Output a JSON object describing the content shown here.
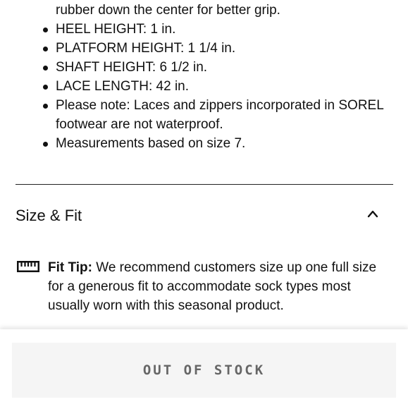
{
  "product_details": {
    "items": [
      {
        "text": "rubber down the center for better grip.",
        "continuation": true
      },
      {
        "text": "HEEL HEIGHT: 1 in.",
        "continuation": false
      },
      {
        "text": "PLATFORM HEIGHT: 1 1/4 in.",
        "continuation": false
      },
      {
        "text": "SHAFT HEIGHT: 6 1/2 in.",
        "continuation": false
      },
      {
        "text": "LACE LENGTH: 42 in.",
        "continuation": false
      },
      {
        "text": "Please note: Laces and zippers incorporated in SOREL footwear are not waterproof.",
        "continuation": false
      },
      {
        "text": "Measurements based on size 7.",
        "continuation": false
      }
    ]
  },
  "size_fit": {
    "title": "Size & Fit",
    "expanded": true,
    "tip_label": "Fit Tip:",
    "tip_text": " We recommend customers size up one full size for a generous fit to accommodate sock types most usually worn with this seasonal product.",
    "tip_icon": "ruler-icon"
  },
  "purchase_bar": {
    "button_label": "OUT OF STOCK",
    "button_state": "disabled"
  },
  "colors": {
    "text": "#111111",
    "button_bg": "#f5f5f5",
    "button_text": "#666666"
  }
}
